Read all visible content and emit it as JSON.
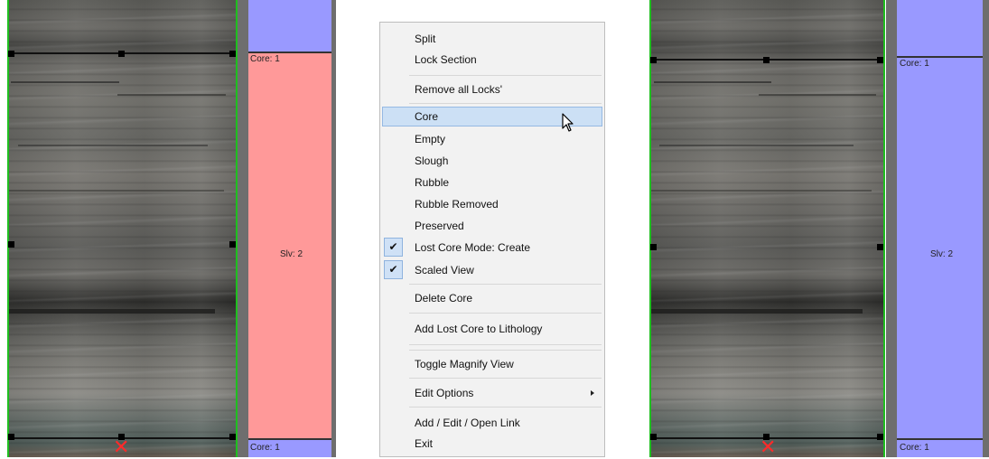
{
  "left_panel": {
    "track": {
      "top_label": "Core: 1",
      "middle_label": "Slv: 2",
      "bottom_label": "Core: 1",
      "top_color": "#9999ff",
      "middle_color": "#ff9999",
      "bottom_color": "#9999ff"
    }
  },
  "context_menu": {
    "items": [
      {
        "label": "Split",
        "checked": false,
        "highlighted": false
      },
      {
        "label": "Lock Section",
        "checked": false,
        "highlighted": false
      },
      {
        "label": "Remove all Locks'",
        "checked": false,
        "highlighted": false
      },
      {
        "label": "Core",
        "checked": false,
        "highlighted": true
      },
      {
        "label": "Empty",
        "checked": false,
        "highlighted": false
      },
      {
        "label": "Slough",
        "checked": false,
        "highlighted": false
      },
      {
        "label": "Rubble",
        "checked": false,
        "highlighted": false
      },
      {
        "label": "Rubble Removed",
        "checked": false,
        "highlighted": false
      },
      {
        "label": "Preserved",
        "checked": false,
        "highlighted": false
      },
      {
        "label": "Lost Core Mode: Create",
        "checked": true,
        "highlighted": false
      },
      {
        "label": "Scaled View",
        "checked": true,
        "highlighted": false
      },
      {
        "label": "Delete Core",
        "checked": false,
        "highlighted": false
      },
      {
        "label": "Add Lost Core to Lithology",
        "checked": false,
        "highlighted": false
      },
      {
        "label": "Toggle Magnify View",
        "checked": false,
        "highlighted": false
      },
      {
        "label": "Edit Options",
        "checked": false,
        "highlighted": false,
        "submenu": true
      },
      {
        "label": "Add / Edit / Open Link",
        "checked": false,
        "highlighted": false
      },
      {
        "label": "Exit",
        "checked": false,
        "highlighted": false
      }
    ],
    "check_glyph": "✔",
    "highlight_color": "#cce0f5"
  },
  "right_panel": {
    "track": {
      "top_label": "Core: 1",
      "middle_label": "Slv: 2",
      "bottom_label": "Core: 1",
      "top_color": "#9999ff",
      "middle_color": "#9999ff",
      "bottom_color": "#9999ff"
    }
  },
  "icons": {
    "mouse_cursor": "cursor-arrow-icon",
    "x_marker": "✕",
    "submenu": "chevron-right-icon"
  }
}
